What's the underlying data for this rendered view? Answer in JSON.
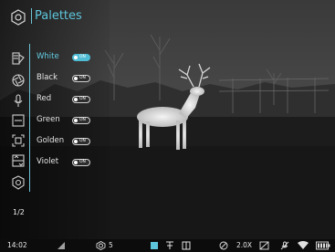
{
  "menu": {
    "title": "Palettes",
    "page_indicator": "1/2",
    "items": [
      {
        "label": "White",
        "toggle": "ON",
        "active": true
      },
      {
        "label": "Black",
        "toggle": "ON",
        "active": false
      },
      {
        "label": "Red",
        "toggle": "ON",
        "active": false
      },
      {
        "label": "Green",
        "toggle": "ON",
        "active": false
      },
      {
        "label": "Golden",
        "toggle": "ON",
        "active": false
      },
      {
        "label": "Violet",
        "toggle": "ON",
        "active": false
      }
    ],
    "side_icons": [
      "palette-icon",
      "lens-icon",
      "microphone-icon",
      "iso-icon",
      "frame-icon",
      "mode-icon",
      "settings-badge-icon"
    ],
    "header_icon": "hexagon-eye-icon"
  },
  "statusbar": {
    "time": "14:02",
    "sensitivity": "5",
    "zoom": "2.0X",
    "icons": [
      "signal-icon",
      "aperture-icon",
      "thermal-mode-icons",
      "no-record-icon",
      "calibration-icon",
      "no-mic-icon",
      "wifi-icon",
      "battery-icon"
    ]
  },
  "colors": {
    "accent": "#5ec6dc",
    "text": "#e6e6e6",
    "background": "#1a1a1a"
  }
}
